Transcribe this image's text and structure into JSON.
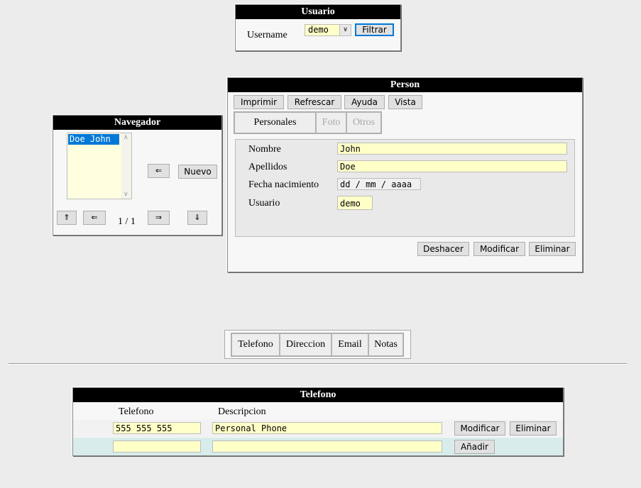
{
  "usuario_panel": {
    "title": "Usuario",
    "username_label": "Username",
    "username_value": "demo",
    "filter_button": "Filtrar"
  },
  "navegador_panel": {
    "title": "Navegador",
    "list_items": [
      "Doe John"
    ],
    "back_arrow": "⇐",
    "new_button": "Nuevo",
    "first_button": "⇑",
    "prev_button": "⇐",
    "page_indicator": "1 / 1",
    "next_button": "⇒",
    "last_button": "⇓"
  },
  "person_panel": {
    "title": "Person",
    "toolbar": [
      "Imprimir",
      "Refrescar",
      "Ayuda",
      "Vista"
    ],
    "tabs": [
      {
        "label": "Personales",
        "enabled": true
      },
      {
        "label": "Foto",
        "enabled": false
      },
      {
        "label": "Otros",
        "enabled": false
      }
    ],
    "fields": {
      "nombre_label": "Nombre",
      "nombre_value": "John",
      "apellidos_label": "Apellidos",
      "apellidos_value": "Doe",
      "fecha_label": "Fecha nacimiento",
      "fecha_placeholder": "dd / mm / aaaa",
      "usuario_label": "Usuario",
      "usuario_value": "demo"
    },
    "actions": [
      "Deshacer",
      "Modificar",
      "Eliminar"
    ]
  },
  "detail_tabs": [
    "Telefono",
    "Direccion",
    "Email",
    "Notas"
  ],
  "telefono_panel": {
    "title": "Telefono",
    "col_telefono": "Telefono",
    "col_descripcion": "Descripcion",
    "rows": [
      {
        "telefono": "555 555 555",
        "descripcion": "Personal Phone",
        "modify": "Modificar",
        "delete": "Eliminar"
      }
    ],
    "new_row": {
      "telefono": "",
      "descripcion": "",
      "add": "Añadir"
    }
  }
}
